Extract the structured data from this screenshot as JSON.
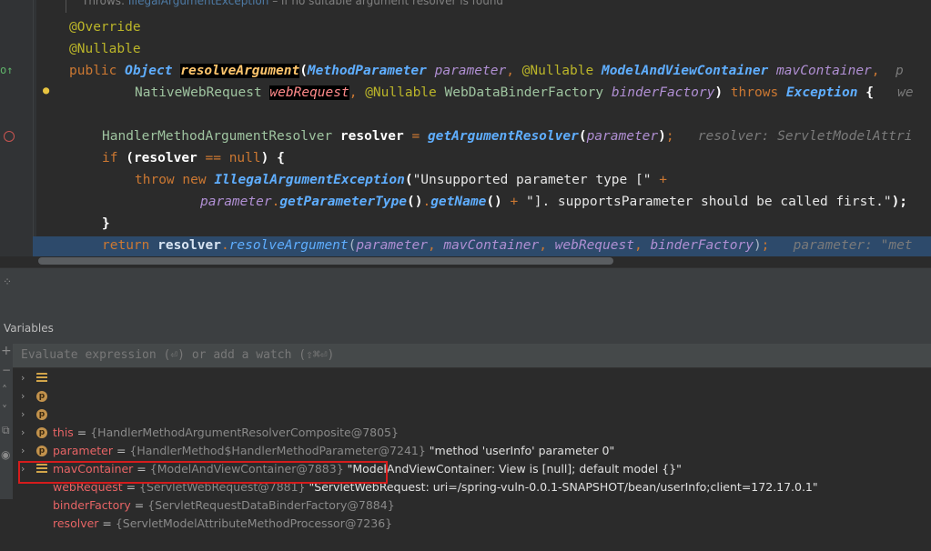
{
  "editor": {
    "doc_prefix": "Throws: ",
    "doc_link": "IllegalArgumentException",
    "doc_suffix": " – if no suitable argument resolver is found",
    "ann_override": "@Override",
    "ann_nullable": "@Nullable",
    "l3": {
      "public": "public ",
      "type": "Object",
      "sp": " ",
      "name": "resolveArgument",
      "paren": "(",
      "ptype1": "MethodParameter",
      "p1": " parameter",
      "comma1": ", ",
      "ann": "@Nullable",
      "ptype2": " ModelAndViewContainer",
      "p2": " mavContainer",
      "comma2": ",  ",
      "hint": "p"
    },
    "l4": {
      "type1": "NativeWebRequest",
      "p1": "webRequest",
      "comma": ", ",
      "ann": "@Nullable",
      "type2": " WebDataBinderFactory",
      "p2": " binderFactory",
      "close": ")",
      "throws": " throws ",
      "ex": "Exception",
      "brace": " {",
      "hint": "   we"
    },
    "l5": {
      "type": "HandlerMethodArgumentResolver",
      "var": " resolver",
      "eq": " = ",
      "call": "getArgumentResolver",
      "open": "(",
      "arg": "parameter",
      "close": ")",
      "semi": ";",
      "hint": "   resolver: ServletModelAttri"
    },
    "l6": {
      "if": "if ",
      "open": "(",
      "var": "resolver",
      "op": " == ",
      "null": "null",
      "close": ")",
      "brace": " {"
    },
    "l7": {
      "throw": "throw ",
      "new": "new ",
      "ex": "IllegalArgumentException",
      "open": "(",
      "str": "\"Unsupported parameter type [\"",
      "plus": " +"
    },
    "l8": {
      "param": "parameter",
      "dot1": ".",
      "m1": "getParameterType",
      "p1": "()",
      "dot2": ".",
      "m2": "getName",
      "p2": "()",
      "plus": " + ",
      "str": "\"]. supportsParameter should be called first.\"",
      "end": ");"
    },
    "l9": "}",
    "l10": {
      "return": "return ",
      "var": "resolver",
      "dot": ".",
      "call": "resolveArgument",
      "open": "(",
      "a1": "parameter",
      "c1": ", ",
      "a2": "mavContainer",
      "c2": ", ",
      "a3": "webRequest",
      "c3": ", ",
      "a4": "binderFactory",
      "close": ")",
      "semi": ";",
      "hint": "   parameter: \"met"
    }
  },
  "debugger": {
    "panel_title": "Variables",
    "watch_placeholder": "Evaluate expression (⏎) or add a watch (⇧⌘⏎)",
    "variables": [
      {
        "icon": "field-icon",
        "name": "this",
        "eq": " = ",
        "type": "{HandlerMethodArgumentResolverComposite@7805}",
        "value": ""
      },
      {
        "icon": "param-icon",
        "name": "parameter",
        "eq": " = ",
        "type": "{HandlerMethod$HandlerMethodParameter@7241}",
        "value": " \"method 'userInfo' parameter 0\""
      },
      {
        "icon": "param-icon",
        "name": "mavContainer",
        "eq": " = ",
        "type": "{ModelAndViewContainer@7883}",
        "value": " \"ModelAndViewContainer: View is [null]; default model {}\""
      },
      {
        "icon": "param-icon",
        "name": "webRequest",
        "eq": " = ",
        "type": "{ServletWebRequest@7881}",
        "value": " \"ServletWebRequest: uri=/spring-vuln-0.0.1-SNAPSHOT/bean/userInfo;client=172.17.0.1\""
      },
      {
        "icon": "param-icon",
        "name": "binderFactory",
        "eq": " = ",
        "type": "{ServletRequestDataBinderFactory@7884}",
        "value": ""
      },
      {
        "icon": "field-icon",
        "name": "resolver",
        "eq": " = ",
        "type": "{ServletModelAttributeMethodProcessor@7236}",
        "value": ""
      }
    ]
  },
  "colors": {
    "highlight_box": "#d51c1c",
    "current_line": "#2d4a6b"
  }
}
